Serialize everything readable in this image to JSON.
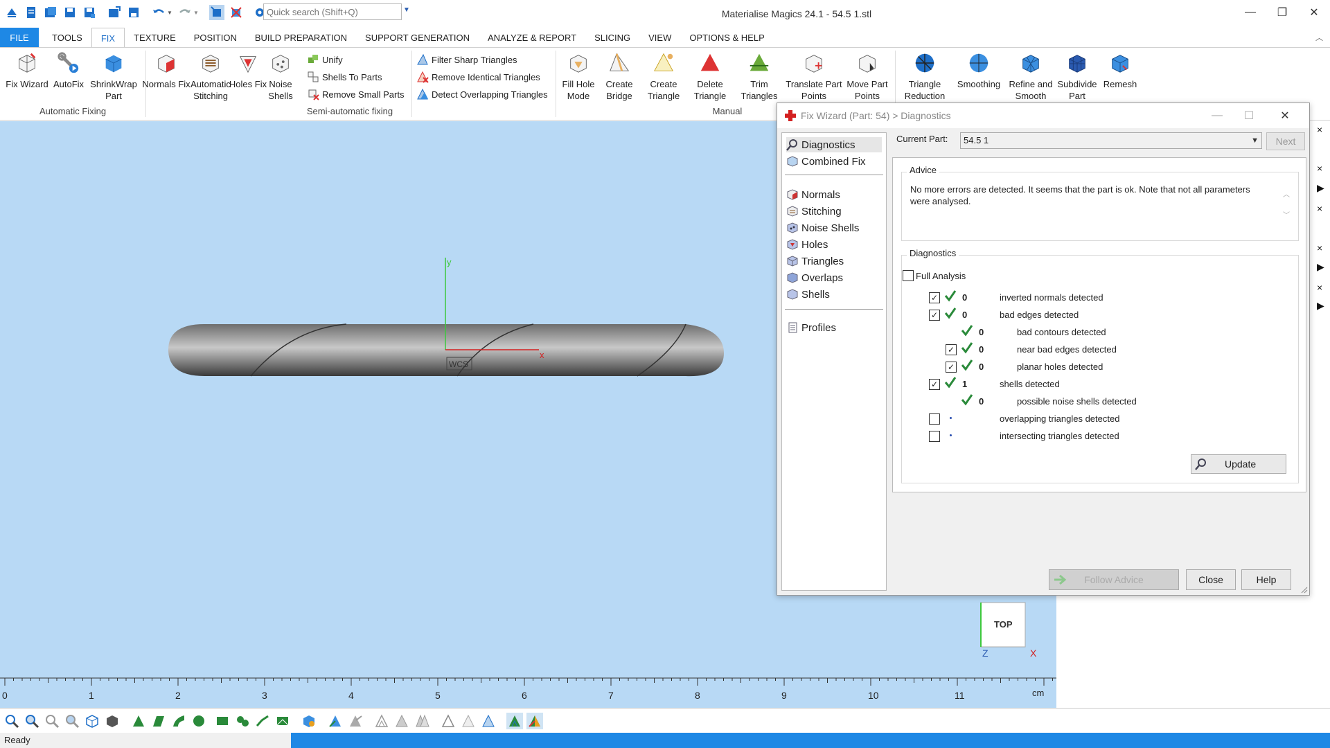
{
  "app": {
    "title": "Materialise Magics 24.1 - 54.5   1.stl",
    "search_placeholder": "Quick search (Shift+Q)"
  },
  "menu": {
    "tabs": [
      "FILE",
      "TOOLS",
      "FIX",
      "TEXTURE",
      "POSITION",
      "BUILD PREPARATION",
      "SUPPORT GENERATION",
      "ANALYZE & REPORT",
      "SLICING",
      "VIEW",
      "OPTIONS & HELP"
    ],
    "active": "FIX"
  },
  "ribbon": {
    "groups": {
      "automatic": "Automatic Fixing",
      "semi": "Semi-automatic fixing",
      "manual": "Manual"
    },
    "fix_wizard": "Fix Wizard",
    "autofix": "AutoFix",
    "shrinkwrap": "ShrinkWrap Part",
    "normals_fix": "Normals Fix",
    "auto_stitching": "Automatic Stitching",
    "holes_fix": "Holes Fix",
    "noise_shells": "Noise Shells",
    "unify": "Unify",
    "shells_to_parts": "Shells To Parts",
    "remove_small_parts": "Remove Small Parts",
    "filter_sharp": "Filter Sharp Triangles",
    "remove_identical": "Remove Identical Triangles",
    "detect_overlapping": "Detect Overlapping Triangles",
    "fill_hole": "Fill Hole Mode",
    "create_bridge": "Create Bridge",
    "create_triangle": "Create Triangle",
    "delete_triangle": "Delete Triangle",
    "trim_triangles": "Trim Triangles",
    "translate_part": "Translate Part Points",
    "move_part": "Move Part Points",
    "triangle_reduction": "Triangle Reduction",
    "smoothing": "Smoothing",
    "refine_smooth": "Refine and Smooth",
    "subdivide": "Subdivide Part",
    "remesh": "Remesh"
  },
  "viewport": {
    "axis_y": "y",
    "axis_x": "x",
    "wcs": "WCS",
    "cube_label": "TOP",
    "cube_z": "Z",
    "cube_x": "X",
    "ruler_ticks": [
      "0",
      "1",
      "2",
      "3",
      "4",
      "5",
      "6",
      "7",
      "8",
      "9",
      "10",
      "11"
    ],
    "ruler_unit": "cm"
  },
  "status": {
    "text": "Ready"
  },
  "dialog": {
    "title": "Fix Wizard (Part: 54) > Diagnostics",
    "nav": [
      "Diagnostics",
      "Combined Fix",
      "Normals",
      "Stitching",
      "Noise Shells",
      "Holes",
      "Triangles",
      "Overlaps",
      "Shells",
      "Profiles"
    ],
    "current_part_label": "Current Part:",
    "current_part_value": "54.5   1",
    "next": "Next",
    "advice_label": "Advice",
    "advice_text": "No more errors are detected. It seems that the part is ok. Note that not all parameters were analysed.",
    "diagnostics_label": "Diagnostics",
    "full_analysis": "Full Analysis",
    "rows": [
      {
        "value": "0",
        "label": "inverted normals detected"
      },
      {
        "value": "0",
        "label": "bad edges detected"
      },
      {
        "value": "0",
        "label": "bad contours detected"
      },
      {
        "value": "0",
        "label": "near bad edges detected"
      },
      {
        "value": "0",
        "label": "planar holes detected"
      },
      {
        "value": "1",
        "label": "shells detected"
      },
      {
        "value": "0",
        "label": "possible noise shells detected"
      },
      {
        "value": "",
        "label": "overlapping triangles detected"
      },
      {
        "value": "",
        "label": "intersecting triangles detected"
      }
    ],
    "update": "Update",
    "follow_advice": "Follow Advice",
    "close": "Close",
    "help": "Help"
  }
}
